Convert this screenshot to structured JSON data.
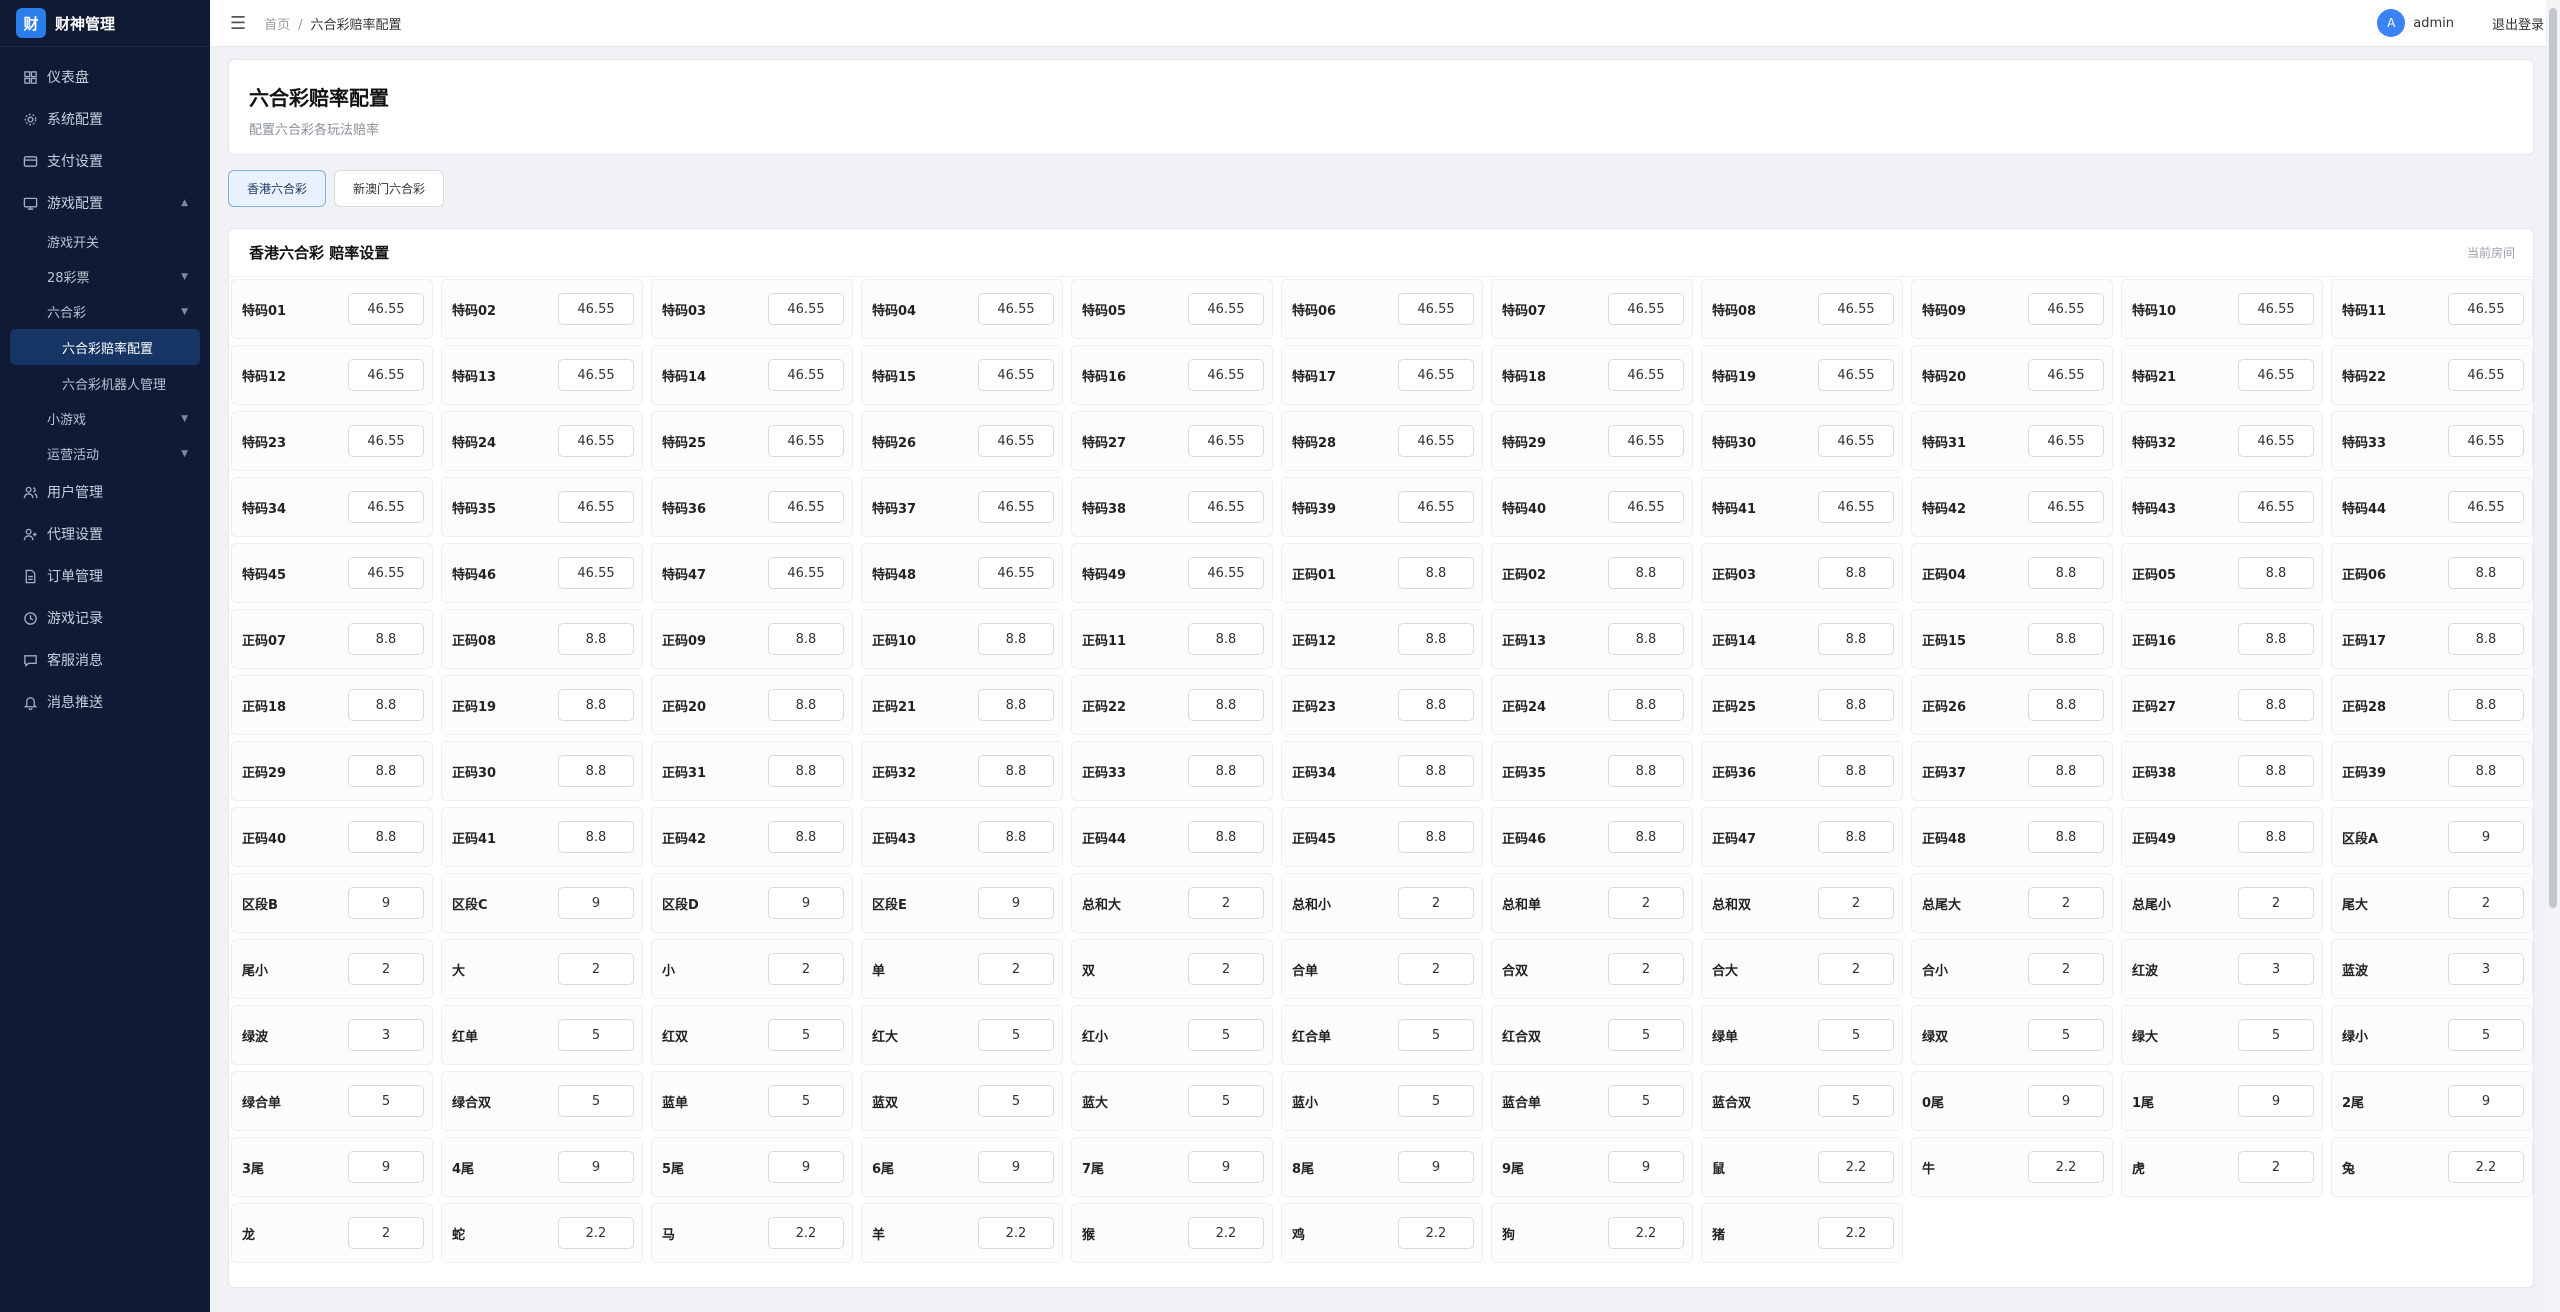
{
  "app": {
    "logo_char": "财",
    "title": "财神管理"
  },
  "menu": [
    {
      "label": "仪表盘",
      "icon": "dashboard-icon"
    },
    {
      "label": "系统配置",
      "icon": "gear-icon"
    },
    {
      "label": "支付设置",
      "icon": "card-icon"
    },
    {
      "label": "游戏配置",
      "icon": "monitor-icon",
      "arrow": "▲"
    }
  ],
  "submenu": {
    "game_switch": "游戏开关",
    "pc28": "28彩票",
    "lhc": "六合彩",
    "lhc_odds": "六合彩赔率配置",
    "lhc_bot": "六合彩机器人管理",
    "mini_game": "小游戏",
    "operations": "运营活动"
  },
  "menu2": [
    {
      "label": "用户管理",
      "icon": "users-icon"
    },
    {
      "label": "代理设置",
      "icon": "agent-icon"
    },
    {
      "label": "订单管理",
      "icon": "document-icon"
    },
    {
      "label": "游戏记录",
      "icon": "clock-icon"
    },
    {
      "label": "客服消息",
      "icon": "chat-icon"
    },
    {
      "label": "消息推送",
      "icon": "bell-icon"
    }
  ],
  "topbar": {
    "home": "首页",
    "sep": "/",
    "current": "六合彩赔率配置",
    "avatar": "A",
    "user": "admin",
    "logout": "退出登录"
  },
  "header": {
    "title": "六合彩赔率配置",
    "subtitle": "配置六合彩各玩法赔率"
  },
  "tabs": [
    {
      "label": "香港六合彩",
      "active": true
    },
    {
      "label": "新澳门六合彩",
      "active": false
    }
  ],
  "section": {
    "title": "香港六合彩 赔率设置",
    "right": "当前房间"
  },
  "odds": [
    {
      "label": "特码01",
      "value": "46.55"
    },
    {
      "label": "特码02",
      "value": "46.55"
    },
    {
      "label": "特码03",
      "value": "46.55"
    },
    {
      "label": "特码04",
      "value": "46.55"
    },
    {
      "label": "特码05",
      "value": "46.55"
    },
    {
      "label": "特码06",
      "value": "46.55"
    },
    {
      "label": "特码07",
      "value": "46.55"
    },
    {
      "label": "特码08",
      "value": "46.55"
    },
    {
      "label": "特码09",
      "value": "46.55"
    },
    {
      "label": "特码10",
      "value": "46.55"
    },
    {
      "label": "特码11",
      "value": "46.55"
    },
    {
      "label": "特码12",
      "value": "46.55"
    },
    {
      "label": "特码13",
      "value": "46.55"
    },
    {
      "label": "特码14",
      "value": "46.55"
    },
    {
      "label": "特码15",
      "value": "46.55"
    },
    {
      "label": "特码16",
      "value": "46.55"
    },
    {
      "label": "特码17",
      "value": "46.55"
    },
    {
      "label": "特码18",
      "value": "46.55"
    },
    {
      "label": "特码19",
      "value": "46.55"
    },
    {
      "label": "特码20",
      "value": "46.55"
    },
    {
      "label": "特码21",
      "value": "46.55"
    },
    {
      "label": "特码22",
      "value": "46.55"
    },
    {
      "label": "特码23",
      "value": "46.55"
    },
    {
      "label": "特码24",
      "value": "46.55"
    },
    {
      "label": "特码25",
      "value": "46.55"
    },
    {
      "label": "特码26",
      "value": "46.55"
    },
    {
      "label": "特码27",
      "value": "46.55"
    },
    {
      "label": "特码28",
      "value": "46.55"
    },
    {
      "label": "特码29",
      "value": "46.55"
    },
    {
      "label": "特码30",
      "value": "46.55"
    },
    {
      "label": "特码31",
      "value": "46.55"
    },
    {
      "label": "特码32",
      "value": "46.55"
    },
    {
      "label": "特码33",
      "value": "46.55"
    },
    {
      "label": "特码34",
      "value": "46.55"
    },
    {
      "label": "特码35",
      "value": "46.55"
    },
    {
      "label": "特码36",
      "value": "46.55"
    },
    {
      "label": "特码37",
      "value": "46.55"
    },
    {
      "label": "特码38",
      "value": "46.55"
    },
    {
      "label": "特码39",
      "value": "46.55"
    },
    {
      "label": "特码40",
      "value": "46.55"
    },
    {
      "label": "特码41",
      "value": "46.55"
    },
    {
      "label": "特码42",
      "value": "46.55"
    },
    {
      "label": "特码43",
      "value": "46.55"
    },
    {
      "label": "特码44",
      "value": "46.55"
    },
    {
      "label": "特码45",
      "value": "46.55"
    },
    {
      "label": "特码46",
      "value": "46.55"
    },
    {
      "label": "特码47",
      "value": "46.55"
    },
    {
      "label": "特码48",
      "value": "46.55"
    },
    {
      "label": "特码49",
      "value": "46.55"
    },
    {
      "label": "正码01",
      "value": "8.8"
    },
    {
      "label": "正码02",
      "value": "8.8"
    },
    {
      "label": "正码03",
      "value": "8.8"
    },
    {
      "label": "正码04",
      "value": "8.8"
    },
    {
      "label": "正码05",
      "value": "8.8"
    },
    {
      "label": "正码06",
      "value": "8.8"
    },
    {
      "label": "正码07",
      "value": "8.8"
    },
    {
      "label": "正码08",
      "value": "8.8"
    },
    {
      "label": "正码09",
      "value": "8.8"
    },
    {
      "label": "正码10",
      "value": "8.8"
    },
    {
      "label": "正码11",
      "value": "8.8"
    },
    {
      "label": "正码12",
      "value": "8.8"
    },
    {
      "label": "正码13",
      "value": "8.8"
    },
    {
      "label": "正码14",
      "value": "8.8"
    },
    {
      "label": "正码15",
      "value": "8.8"
    },
    {
      "label": "正码16",
      "value": "8.8"
    },
    {
      "label": "正码17",
      "value": "8.8"
    },
    {
      "label": "正码18",
      "value": "8.8"
    },
    {
      "label": "正码19",
      "value": "8.8"
    },
    {
      "label": "正码20",
      "value": "8.8"
    },
    {
      "label": "正码21",
      "value": "8.8"
    },
    {
      "label": "正码22",
      "value": "8.8"
    },
    {
      "label": "正码23",
      "value": "8.8"
    },
    {
      "label": "正码24",
      "value": "8.8"
    },
    {
      "label": "正码25",
      "value": "8.8"
    },
    {
      "label": "正码26",
      "value": "8.8"
    },
    {
      "label": "正码27",
      "value": "8.8"
    },
    {
      "label": "正码28",
      "value": "8.8"
    },
    {
      "label": "正码29",
      "value": "8.8"
    },
    {
      "label": "正码30",
      "value": "8.8"
    },
    {
      "label": "正码31",
      "value": "8.8"
    },
    {
      "label": "正码32",
      "value": "8.8"
    },
    {
      "label": "正码33",
      "value": "8.8"
    },
    {
      "label": "正码34",
      "value": "8.8"
    },
    {
      "label": "正码35",
      "value": "8.8"
    },
    {
      "label": "正码36",
      "value": "8.8"
    },
    {
      "label": "正码37",
      "value": "8.8"
    },
    {
      "label": "正码38",
      "value": "8.8"
    },
    {
      "label": "正码39",
      "value": "8.8"
    },
    {
      "label": "正码40",
      "value": "8.8"
    },
    {
      "label": "正码41",
      "value": "8.8"
    },
    {
      "label": "正码42",
      "value": "8.8"
    },
    {
      "label": "正码43",
      "value": "8.8"
    },
    {
      "label": "正码44",
      "value": "8.8"
    },
    {
      "label": "正码45",
      "value": "8.8"
    },
    {
      "label": "正码46",
      "value": "8.8"
    },
    {
      "label": "正码47",
      "value": "8.8"
    },
    {
      "label": "正码48",
      "value": "8.8"
    },
    {
      "label": "正码49",
      "value": "8.8"
    },
    {
      "label": "区段A",
      "value": "9"
    },
    {
      "label": "区段B",
      "value": "9"
    },
    {
      "label": "区段C",
      "value": "9"
    },
    {
      "label": "区段D",
      "value": "9"
    },
    {
      "label": "区段E",
      "value": "9"
    },
    {
      "label": "总和大",
      "value": "2"
    },
    {
      "label": "总和小",
      "value": "2"
    },
    {
      "label": "总和单",
      "value": "2"
    },
    {
      "label": "总和双",
      "value": "2"
    },
    {
      "label": "总尾大",
      "value": "2"
    },
    {
      "label": "总尾小",
      "value": "2"
    },
    {
      "label": "尾大",
      "value": "2"
    },
    {
      "label": "尾小",
      "value": "2"
    },
    {
      "label": "大",
      "value": "2"
    },
    {
      "label": "小",
      "value": "2"
    },
    {
      "label": "单",
      "value": "2"
    },
    {
      "label": "双",
      "value": "2"
    },
    {
      "label": "合单",
      "value": "2"
    },
    {
      "label": "合双",
      "value": "2"
    },
    {
      "label": "合大",
      "value": "2"
    },
    {
      "label": "合小",
      "value": "2"
    },
    {
      "label": "红波",
      "value": "3"
    },
    {
      "label": "蓝波",
      "value": "3"
    },
    {
      "label": "绿波",
      "value": "3"
    },
    {
      "label": "红单",
      "value": "5"
    },
    {
      "label": "红双",
      "value": "5"
    },
    {
      "label": "红大",
      "value": "5"
    },
    {
      "label": "红小",
      "value": "5"
    },
    {
      "label": "红合单",
      "value": "5"
    },
    {
      "label": "红合双",
      "value": "5"
    },
    {
      "label": "绿单",
      "value": "5"
    },
    {
      "label": "绿双",
      "value": "5"
    },
    {
      "label": "绿大",
      "value": "5"
    },
    {
      "label": "绿小",
      "value": "5"
    },
    {
      "label": "绿合单",
      "value": "5"
    },
    {
      "label": "绿合双",
      "value": "5"
    },
    {
      "label": "蓝单",
      "value": "5"
    },
    {
      "label": "蓝双",
      "value": "5"
    },
    {
      "label": "蓝大",
      "value": "5"
    },
    {
      "label": "蓝小",
      "value": "5"
    },
    {
      "label": "蓝合单",
      "value": "5"
    },
    {
      "label": "蓝合双",
      "value": "5"
    },
    {
      "label": "0尾",
      "value": "9"
    },
    {
      "label": "1尾",
      "value": "9"
    },
    {
      "label": "2尾",
      "value": "9"
    },
    {
      "label": "3尾",
      "value": "9"
    },
    {
      "label": "4尾",
      "value": "9"
    },
    {
      "label": "5尾",
      "value": "9"
    },
    {
      "label": "6尾",
      "value": "9"
    },
    {
      "label": "7尾",
      "value": "9"
    },
    {
      "label": "8尾",
      "value": "9"
    },
    {
      "label": "9尾",
      "value": "9"
    },
    {
      "label": "鼠",
      "value": "2.2"
    },
    {
      "label": "牛",
      "value": "2.2"
    },
    {
      "label": "虎",
      "value": "2"
    },
    {
      "label": "兔",
      "value": "2.2"
    },
    {
      "label": "龙",
      "value": "2"
    },
    {
      "label": "蛇",
      "value": "2.2"
    },
    {
      "label": "马",
      "value": "2.2"
    },
    {
      "label": "羊",
      "value": "2.2"
    },
    {
      "label": "猴",
      "value": "2.2"
    },
    {
      "label": "鸡",
      "value": "2.2"
    },
    {
      "label": "狗",
      "value": "2.2"
    },
    {
      "label": "猪",
      "value": "2.2"
    }
  ]
}
